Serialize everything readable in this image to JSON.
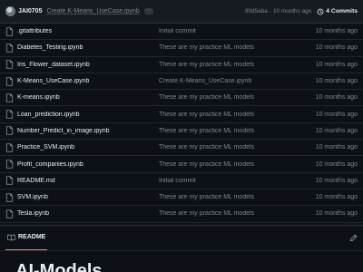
{
  "commit": {
    "author": "JAI0705",
    "message": "Create K-Means_UseCase.ipynb",
    "dots": "···",
    "hash": "90d5aba",
    "separator": "·",
    "time": "10 months ago",
    "history_label": "4 Commits"
  },
  "files": [
    {
      "name": ".gitattributes",
      "message": "Initial commit",
      "time": "10 months ago"
    },
    {
      "name": "Diabetes_Testing.ipynb",
      "message": "These are my practice ML models",
      "time": "10 months ago"
    },
    {
      "name": "Iris_Flower_dataset.ipynb",
      "message": "These are my practice ML models",
      "time": "10 months ago"
    },
    {
      "name": "K-Means_UseCase.ipynb",
      "message": "Create K-Means_UseCase.ipynb",
      "time": "10 months ago"
    },
    {
      "name": "K-means.ipynb",
      "message": "These are my practice ML models",
      "time": "10 months ago"
    },
    {
      "name": "Loan_prediction.ipynb",
      "message": "These are my practice ML models",
      "time": "10 months ago"
    },
    {
      "name": "Number_Predict_in_image.ipynb",
      "message": "These are my practice ML models",
      "time": "10 months ago"
    },
    {
      "name": "Practice_SVM.ipynb",
      "message": "These are my practice ML models",
      "time": "10 months ago"
    },
    {
      "name": "Profit_companies.ipynb",
      "message": "These are my practice ML models",
      "time": "10 months ago"
    },
    {
      "name": "README.md",
      "message": "Initial commit",
      "time": "10 months ago"
    },
    {
      "name": "SVM.ipynb",
      "message": "These are my practice ML models",
      "time": "10 months ago"
    },
    {
      "name": "Tesla.ipynb",
      "message": "These are my practice ML models",
      "time": "10 months ago"
    }
  ],
  "readme": {
    "tab_label": "README",
    "title": "AI-Models"
  },
  "icons": {
    "file": "file-icon",
    "history": "clock-history-icon",
    "readme": "book-icon",
    "edit": "pencil-icon"
  },
  "colors": {
    "background": "#0d1117",
    "header": "#161b22",
    "border": "#30363d",
    "muted_text": "#7d8590",
    "tab_underline": "#f78166"
  }
}
